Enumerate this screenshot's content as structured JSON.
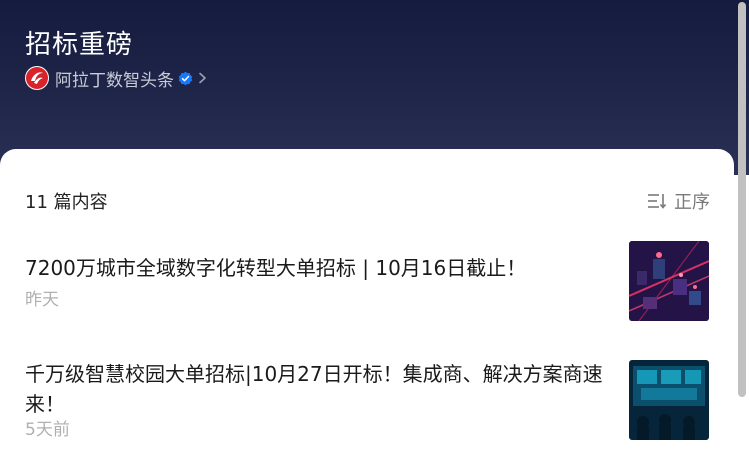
{
  "header": {
    "title": "招标重磅",
    "account_name": "阿拉丁数智头条",
    "logo_icon": "aladdin-logo",
    "verified_icon": "verified-badge-icon",
    "accent": "#1677ff"
  },
  "list": {
    "count_label": "11 篇内容",
    "sort_label": "正序",
    "sort_icon": "sort-icon",
    "items": [
      {
        "title": "7200万城市全域数字化转型大单招标 | 10月16日截止！",
        "time": "昨天",
        "thumb": "smart-city-thumbnail"
      },
      {
        "title": "千万级智慧校园大单招标|10月27日开标！集成商、解决方案商速来！",
        "time": "5天前",
        "thumb": "smart-campus-thumbnail"
      }
    ]
  }
}
